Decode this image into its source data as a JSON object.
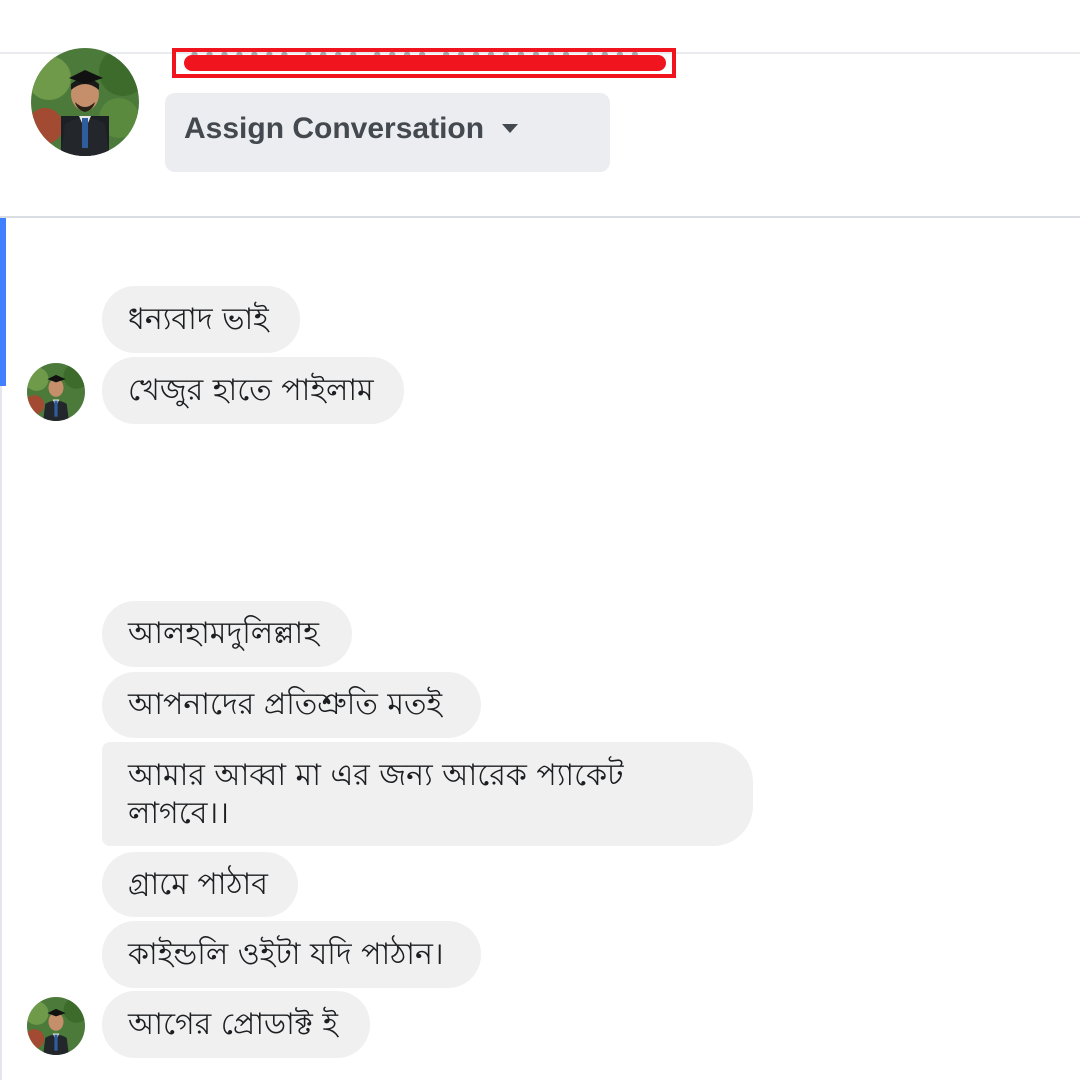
{
  "header": {
    "redacted_name": "••••••• •••• •••• ••••••••• ••••",
    "assign_button_label": "Assign Conversation",
    "assign_caret_icon": "caret-down-icon"
  },
  "messages": [
    {
      "text": "ধন্যবাদ ভাই"
    },
    {
      "text": "খেজুর হাতে পাইলাম"
    },
    {
      "text": "আলহামদুলিল্লাহ"
    },
    {
      "text": "আপনাদের প্রতিশ্রুতি মতই"
    },
    {
      "line1": "আমার আব্বা মা এর জন্য আরেক প্যাকেট",
      "line2": "লাগবে।।"
    },
    {
      "text": "গ্রামে পাঠাব"
    },
    {
      "text": "কাইন্ডলি ওইটা যদি পাঠান।"
    },
    {
      "text": "আগের প্রোডাক্ট ই"
    }
  ],
  "colors": {
    "bubble_bg": "#f0f0f0",
    "button_bg": "#ebedf0",
    "accent_blue": "#4080ff",
    "redaction_red": "#f0141e"
  }
}
